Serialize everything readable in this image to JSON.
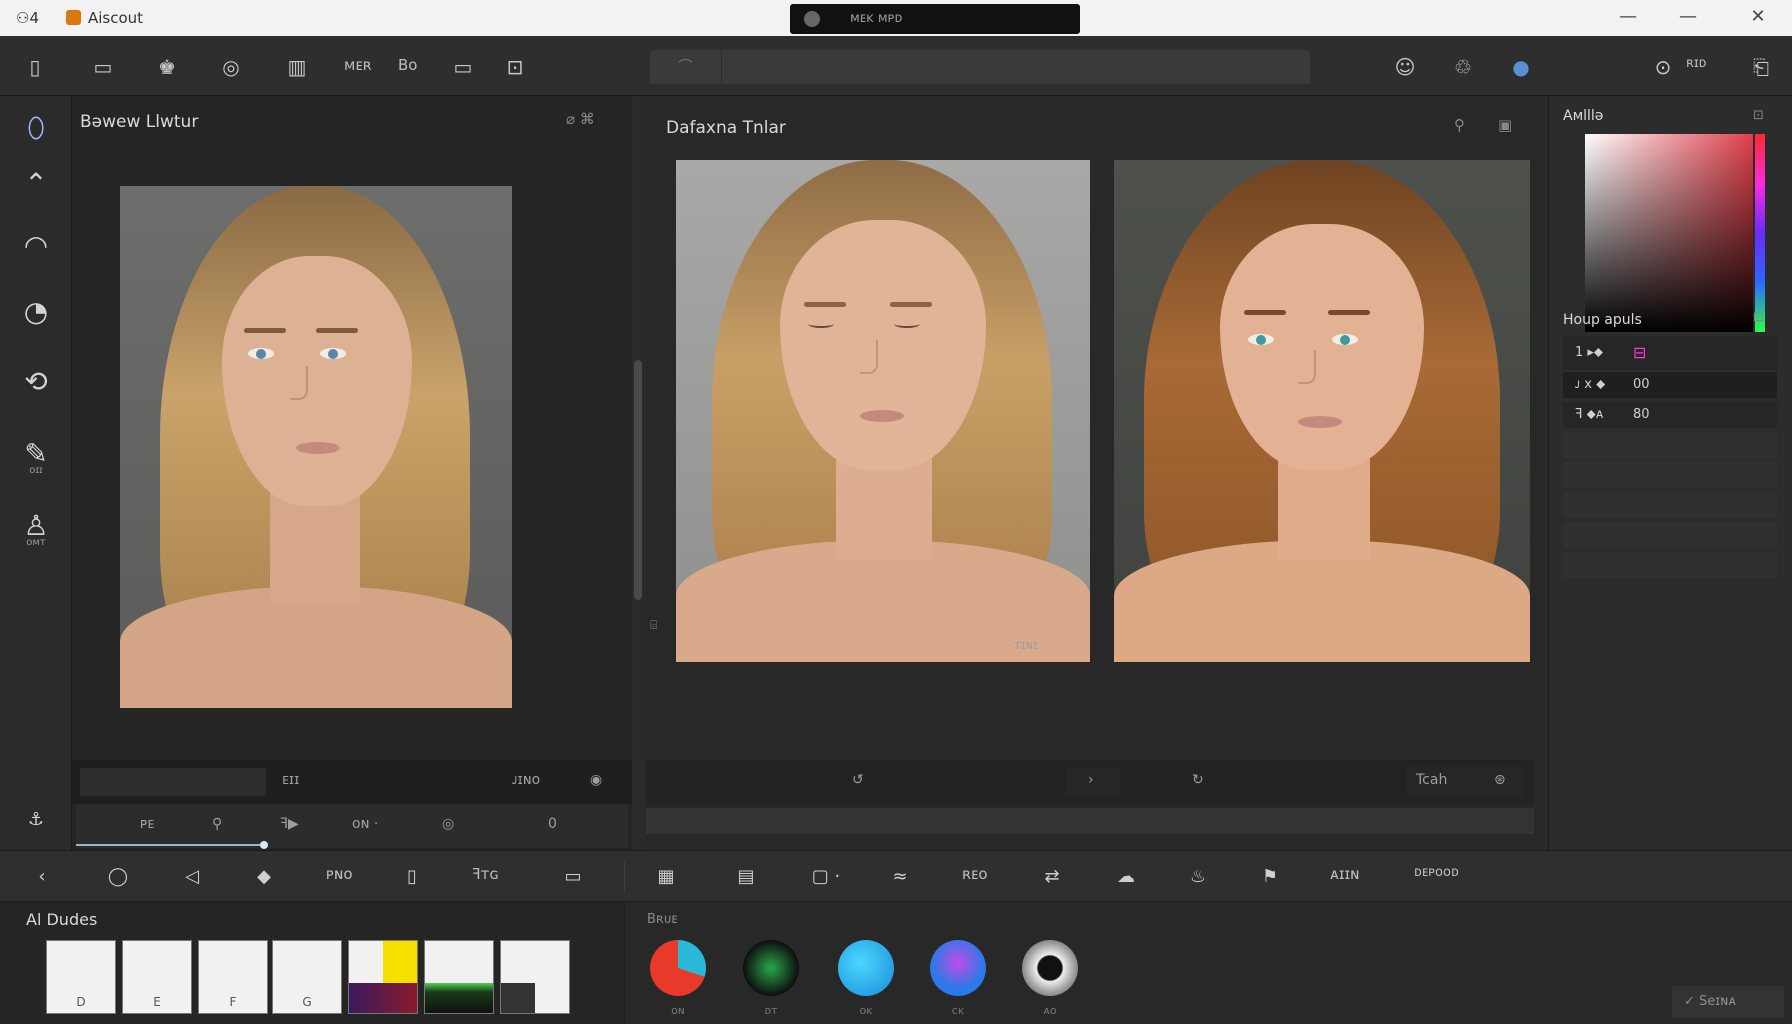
{
  "titlebar": {
    "glyph": "⚇4",
    "app_name": "Aiscout",
    "doc_tab": "ᴍᴇᴋ ᴍᴘᴅ",
    "minimize": "—",
    "maximize": "—",
    "close": "✕"
  },
  "toolbar": {
    "text_a": "ᴍᴇʀ",
    "text_b": "Bo",
    "right_label": "ʀɪᴅ",
    "search_seg": "⌒"
  },
  "rail": {
    "tool_6_label": "ᴏɪɪ",
    "tool_7_label": "ᴏᴍᴛ"
  },
  "left_panel": {
    "title": "Bəwew Llwtur",
    "ctrl": "⌀  ⌘",
    "field_label": "ᴇɪɪ",
    "status": "ᴊɪɴᴏ",
    "controls": [
      "ᴘᴇ",
      "⚲",
      "ꟻ▶",
      "ᴏɴ ·",
      "◎",
      "0"
    ]
  },
  "center_panel": {
    "title": "Dafaxna Tnlar",
    "caption": "ᴛɪɴɪ",
    "btn_right": "Tcah",
    "marker": "⌸"
  },
  "right_panel": {
    "title": "Aᴍlllə",
    "section_title": "Houp apuls",
    "rows": [
      {
        "label": "1 ▸⬥",
        "value": "⊟"
      },
      {
        "label": "ᴊ x ⬥",
        "value": "00"
      },
      {
        "label": "ꟻ ⬥ᴀ",
        "value": "80"
      }
    ]
  },
  "bottombar": {
    "label_a": "ᴘɴᴏ",
    "label_b": "ꟻᴛɢ",
    "label_c": "ʀᴇᴏ",
    "label_d": "ᴀɪɪɴ",
    "label_e": "ᴅᴇᴘᴏᴏᴅ"
  },
  "ai_dudes": {
    "title": "Al Dudes",
    "swatches": [
      "D",
      "E",
      "F",
      "G",
      "",
      "",
      ""
    ]
  },
  "brushes": {
    "title": "Bʀᴜᴇ",
    "labels": [
      "ᴏɴ",
      "ᴅᴛ",
      "ᴏᴋ",
      "ᴄᴋ",
      "ᴀᴏ"
    ]
  },
  "footer_btn": "✓ Seɪɴᴀ"
}
